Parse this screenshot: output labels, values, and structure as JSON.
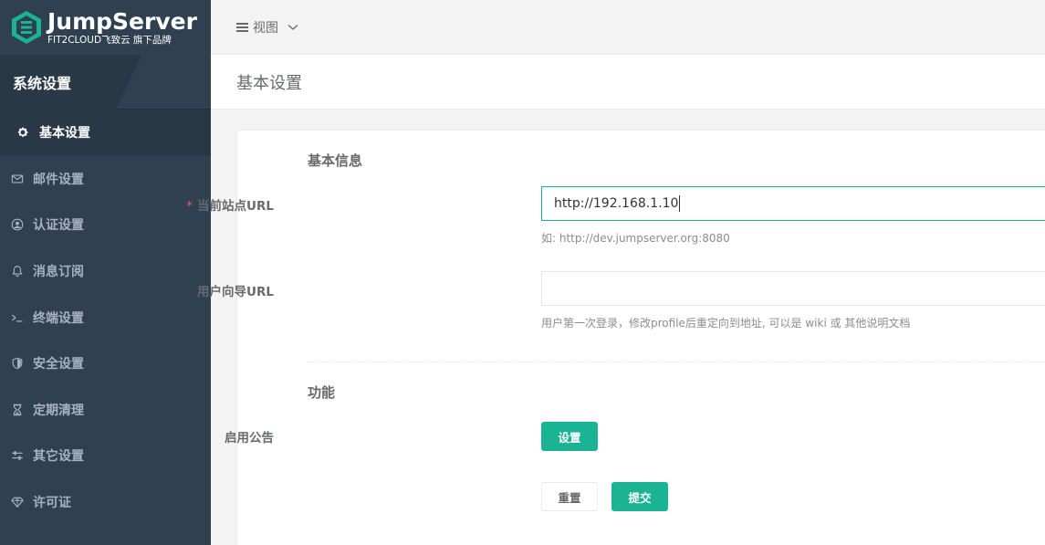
{
  "brand": {
    "name": "JumpServer",
    "tagline": "FIT2CLOUD飞致云 旗下品牌"
  },
  "sidebar": {
    "header": "系统设置",
    "items": [
      {
        "label": "基本设置",
        "icon": "gear-icon",
        "active": true
      },
      {
        "label": "邮件设置",
        "icon": "envelope-icon"
      },
      {
        "label": "认证设置",
        "icon": "user-circle-icon"
      },
      {
        "label": "消息订阅",
        "icon": "bell-icon"
      },
      {
        "label": "终端设置",
        "icon": "terminal-icon"
      },
      {
        "label": "安全设置",
        "icon": "shield-icon"
      },
      {
        "label": "定期清理",
        "icon": "hourglass-icon"
      },
      {
        "label": "其它设置",
        "icon": "sliders-icon"
      },
      {
        "label": "许可证",
        "icon": "diamond-icon"
      }
    ]
  },
  "topbar": {
    "view_label": "视图"
  },
  "page": {
    "title": "基本设置"
  },
  "form": {
    "basic_info_title": "基本信息",
    "site_url": {
      "label": "当前站点URL",
      "required_mark": "*",
      "value": "http://192.168.1.10",
      "help": "如: http://dev.jumpserver.org:8080"
    },
    "user_guide_url": {
      "label": "用户向导URL",
      "value": "",
      "help": "用户第一次登录，修改profile后重定向到地址, 可以是 wiki 或 其他说明文档"
    },
    "features_title": "功能",
    "announcement": {
      "label": "启用公告",
      "button": "设置"
    },
    "reset_button": "重置",
    "submit_button": "提交"
  },
  "colors": {
    "sidebar_bg": "#2f4050",
    "primary": "#1ab394",
    "required": "#ed5565"
  }
}
